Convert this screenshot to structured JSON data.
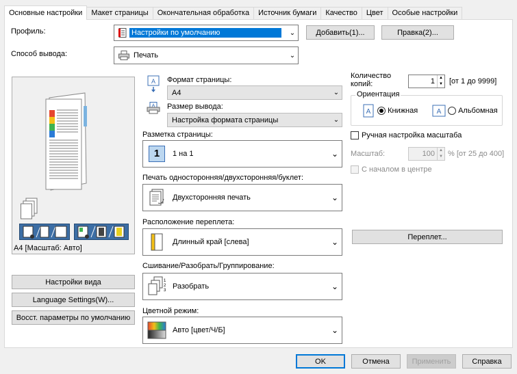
{
  "tabs": [
    "Основные настройки",
    "Макет страницы",
    "Окончательная обработка",
    "Источник бумаги",
    "Качество",
    "Цвет",
    "Особые настройки"
  ],
  "profile": {
    "label": "Профиль:",
    "value": "Настройки по умолчанию",
    "add_button": "Добавить(1)...",
    "edit_button": "Правка(2)..."
  },
  "output": {
    "label": "Способ вывода:",
    "value": "Печать"
  },
  "preview": {
    "caption": "A4 [Масштаб: Авто]"
  },
  "left_buttons": {
    "view_settings": "Настройки вида",
    "language": "Language Settings(W)...",
    "restore": "Восст. параметры по умолчанию"
  },
  "page_size": {
    "label": "Формат страницы:",
    "value": "A4"
  },
  "output_size": {
    "label": "Размер вывода:",
    "value": "Настройка формата страницы"
  },
  "layout": {
    "label": "Разметка страницы:",
    "value": "1 на 1",
    "icon_digit": "1"
  },
  "duplex": {
    "label": "Печать односторонняя/двухсторонняя/буклет:",
    "value": "Двухсторонняя печать"
  },
  "binding": {
    "label": "Расположение переплета:",
    "value": "Длинный край [слева]"
  },
  "collate": {
    "label": "Сшивание/Разобрать/Группирование:",
    "value": "Разобрать"
  },
  "color_mode": {
    "label": "Цветной режим:",
    "value": "Авто [цвет/Ч/Б]"
  },
  "copies": {
    "label_line1": "Количество",
    "label_line2": "копий:",
    "value": "1",
    "range": "[от 1 до 9999]"
  },
  "orientation": {
    "label": "Ориентация",
    "portrait": "Книжная",
    "landscape": "Альбомная",
    "selected": "portrait"
  },
  "manual_scale": {
    "label": "Ручная настройка масштаба"
  },
  "scale": {
    "label": "Масштаб:",
    "value": "100",
    "range": "% [от 25 до 400]"
  },
  "center": {
    "label": "С началом в центре"
  },
  "gutter_button": "Переплет...",
  "footer": {
    "ok": "OK",
    "cancel": "Отмена",
    "apply": "Применить",
    "help": "Справка"
  },
  "colors": {
    "accent": "#0078d7",
    "panel": "#ffffff",
    "window": "#f0f0f0"
  }
}
